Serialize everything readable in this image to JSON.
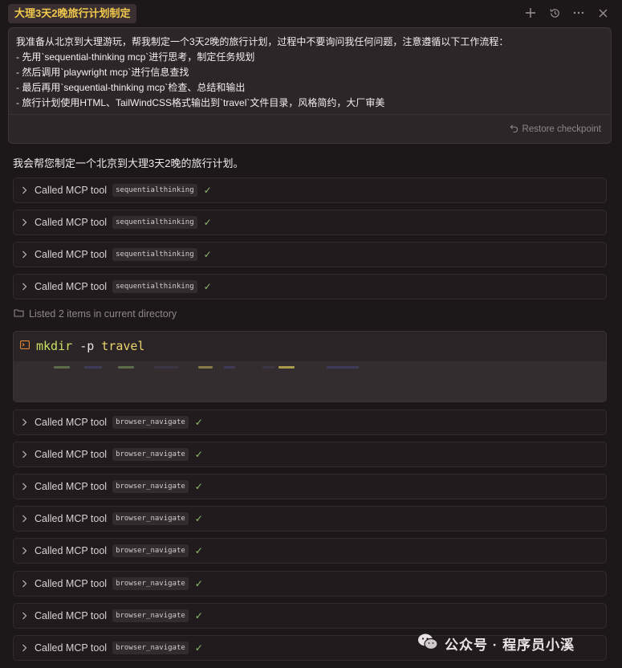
{
  "header": {
    "title": "大理3天2晚旅行计划制定",
    "icons": [
      "plus-icon",
      "history-icon",
      "more-icon",
      "close-icon"
    ]
  },
  "prompt": {
    "lines": [
      "我准备从北京到大理游玩，帮我制定一个3天2晚的旅行计划，过程中不要询问我任何问题，注意遵循以下工作流程：",
      "- 先用`sequential-thinking mcp`进行思考，制定任务规划",
      "- 然后调用`playwright mcp`进行信息查找",
      "- 最后再用`sequential-thinking mcp`检查、总结和输出",
      "- 旅行计划使用HTML、TailWindCSS格式输出到`travel`文件目录，风格简约，大厂审美"
    ],
    "restore_label": "Restore checkpoint"
  },
  "response": {
    "intro": "我会帮您制定一个北京到大理3天2晚的旅行计划。",
    "tool_label": "Called MCP tool",
    "thinking_tool": "sequentialthinking",
    "nav_tool": "browser_navigate",
    "listed_label": "Listed 2 items in current directory",
    "terminal": {
      "cmd": "mkdir",
      "flag": "-p",
      "arg": "travel"
    }
  },
  "colors": {
    "title_accent": "#f2c94c",
    "check": "#8fbf6a",
    "cmd_green": "#c8e064",
    "cmd_yellow": "#ebd46c"
  },
  "watermark": {
    "text": "公众号 · 程序员小溪"
  }
}
